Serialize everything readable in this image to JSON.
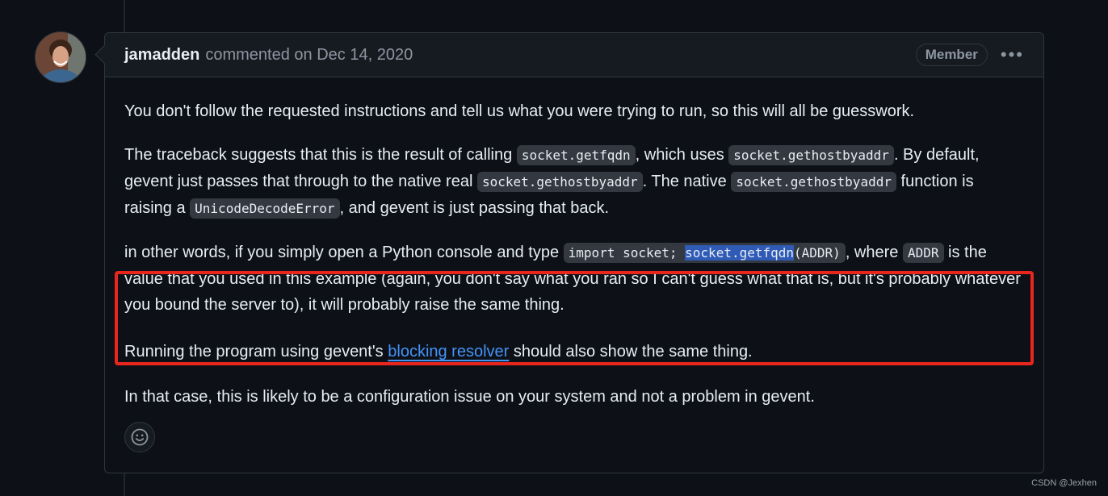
{
  "comment": {
    "author": "jamadden",
    "meta": "commented on Dec 14, 2020",
    "role_badge": "Member",
    "menu_icon": "kebab-horizontal-icon",
    "paragraphs": {
      "p1": "You don't follow the requested instructions and tell us what you were trying to run, so this will all be guesswork.",
      "p2": {
        "t1": "The traceback suggests that this is the result of calling ",
        "c1": "socket.getfqdn",
        "t2": ", which uses ",
        "c2": "socket.gethostbyaddr",
        "t3": ". By default, gevent just passes that through to the native real ",
        "c3": "socket.gethostbyaddr",
        "t4": ". The native ",
        "c4": "socket.gethostbyaddr",
        "t5": " function is raising a ",
        "c5": "UnicodeDecodeError",
        "t6": ", and gevent is just passing that back."
      },
      "p3": {
        "t1": "in other words, if you simply open a Python console and type ",
        "c1_pre": "import socket; ",
        "c1_sel": "socket.getfqdn",
        "c1_post": "(ADDR)",
        "t2": ", where ",
        "c2": "ADDR",
        "t3": " is the value that you used in this example (again, you don't say what you ran so I can't guess what that is, but it's probably whatever you bound the server to), it will probably raise the same thing."
      },
      "p4": {
        "t1": "Running the program using gevent's ",
        "link": "blocking resolver",
        "t2": " should also show the same thing."
      },
      "p5": "In that case, this is likely to be a configuration issue on your system and not a problem in gevent."
    },
    "reaction_icon": "smiley-icon"
  },
  "colors": {
    "background": "#0d1117",
    "header_bg": "#161b22",
    "border": "#30363d",
    "link": "#4493f8",
    "annotation_box": "#e8261e",
    "selection": "#2f5bb7"
  },
  "watermark": "CSDN @Jexhen"
}
